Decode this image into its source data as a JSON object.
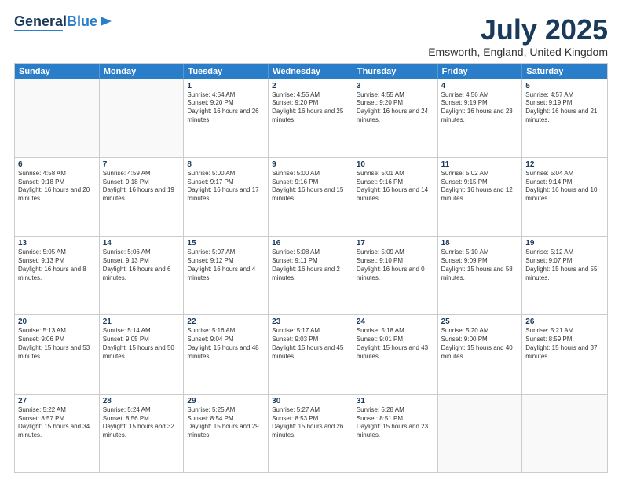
{
  "header": {
    "logo_general": "General",
    "logo_blue": "Blue",
    "month_year": "July 2025",
    "location": "Emsworth, England, United Kingdom"
  },
  "days_of_week": [
    "Sunday",
    "Monday",
    "Tuesday",
    "Wednesday",
    "Thursday",
    "Friday",
    "Saturday"
  ],
  "weeks": [
    [
      {
        "day": "",
        "sunrise": "",
        "sunset": "",
        "daylight": ""
      },
      {
        "day": "",
        "sunrise": "",
        "sunset": "",
        "daylight": ""
      },
      {
        "day": "1",
        "sunrise": "Sunrise: 4:54 AM",
        "sunset": "Sunset: 9:20 PM",
        "daylight": "Daylight: 16 hours and 26 minutes."
      },
      {
        "day": "2",
        "sunrise": "Sunrise: 4:55 AM",
        "sunset": "Sunset: 9:20 PM",
        "daylight": "Daylight: 16 hours and 25 minutes."
      },
      {
        "day": "3",
        "sunrise": "Sunrise: 4:55 AM",
        "sunset": "Sunset: 9:20 PM",
        "daylight": "Daylight: 16 hours and 24 minutes."
      },
      {
        "day": "4",
        "sunrise": "Sunrise: 4:56 AM",
        "sunset": "Sunset: 9:19 PM",
        "daylight": "Daylight: 16 hours and 23 minutes."
      },
      {
        "day": "5",
        "sunrise": "Sunrise: 4:57 AM",
        "sunset": "Sunset: 9:19 PM",
        "daylight": "Daylight: 16 hours and 21 minutes."
      }
    ],
    [
      {
        "day": "6",
        "sunrise": "Sunrise: 4:58 AM",
        "sunset": "Sunset: 9:18 PM",
        "daylight": "Daylight: 16 hours and 20 minutes."
      },
      {
        "day": "7",
        "sunrise": "Sunrise: 4:59 AM",
        "sunset": "Sunset: 9:18 PM",
        "daylight": "Daylight: 16 hours and 19 minutes."
      },
      {
        "day": "8",
        "sunrise": "Sunrise: 5:00 AM",
        "sunset": "Sunset: 9:17 PM",
        "daylight": "Daylight: 16 hours and 17 minutes."
      },
      {
        "day": "9",
        "sunrise": "Sunrise: 5:00 AM",
        "sunset": "Sunset: 9:16 PM",
        "daylight": "Daylight: 16 hours and 15 minutes."
      },
      {
        "day": "10",
        "sunrise": "Sunrise: 5:01 AM",
        "sunset": "Sunset: 9:16 PM",
        "daylight": "Daylight: 16 hours and 14 minutes."
      },
      {
        "day": "11",
        "sunrise": "Sunrise: 5:02 AM",
        "sunset": "Sunset: 9:15 PM",
        "daylight": "Daylight: 16 hours and 12 minutes."
      },
      {
        "day": "12",
        "sunrise": "Sunrise: 5:04 AM",
        "sunset": "Sunset: 9:14 PM",
        "daylight": "Daylight: 16 hours and 10 minutes."
      }
    ],
    [
      {
        "day": "13",
        "sunrise": "Sunrise: 5:05 AM",
        "sunset": "Sunset: 9:13 PM",
        "daylight": "Daylight: 16 hours and 8 minutes."
      },
      {
        "day": "14",
        "sunrise": "Sunrise: 5:06 AM",
        "sunset": "Sunset: 9:13 PM",
        "daylight": "Daylight: 16 hours and 6 minutes."
      },
      {
        "day": "15",
        "sunrise": "Sunrise: 5:07 AM",
        "sunset": "Sunset: 9:12 PM",
        "daylight": "Daylight: 16 hours and 4 minutes."
      },
      {
        "day": "16",
        "sunrise": "Sunrise: 5:08 AM",
        "sunset": "Sunset: 9:11 PM",
        "daylight": "Daylight: 16 hours and 2 minutes."
      },
      {
        "day": "17",
        "sunrise": "Sunrise: 5:09 AM",
        "sunset": "Sunset: 9:10 PM",
        "daylight": "Daylight: 16 hours and 0 minutes."
      },
      {
        "day": "18",
        "sunrise": "Sunrise: 5:10 AM",
        "sunset": "Sunset: 9:09 PM",
        "daylight": "Daylight: 15 hours and 58 minutes."
      },
      {
        "day": "19",
        "sunrise": "Sunrise: 5:12 AM",
        "sunset": "Sunset: 9:07 PM",
        "daylight": "Daylight: 15 hours and 55 minutes."
      }
    ],
    [
      {
        "day": "20",
        "sunrise": "Sunrise: 5:13 AM",
        "sunset": "Sunset: 9:06 PM",
        "daylight": "Daylight: 15 hours and 53 minutes."
      },
      {
        "day": "21",
        "sunrise": "Sunrise: 5:14 AM",
        "sunset": "Sunset: 9:05 PM",
        "daylight": "Daylight: 15 hours and 50 minutes."
      },
      {
        "day": "22",
        "sunrise": "Sunrise: 5:16 AM",
        "sunset": "Sunset: 9:04 PM",
        "daylight": "Daylight: 15 hours and 48 minutes."
      },
      {
        "day": "23",
        "sunrise": "Sunrise: 5:17 AM",
        "sunset": "Sunset: 9:03 PM",
        "daylight": "Daylight: 15 hours and 45 minutes."
      },
      {
        "day": "24",
        "sunrise": "Sunrise: 5:18 AM",
        "sunset": "Sunset: 9:01 PM",
        "daylight": "Daylight: 15 hours and 43 minutes."
      },
      {
        "day": "25",
        "sunrise": "Sunrise: 5:20 AM",
        "sunset": "Sunset: 9:00 PM",
        "daylight": "Daylight: 15 hours and 40 minutes."
      },
      {
        "day": "26",
        "sunrise": "Sunrise: 5:21 AM",
        "sunset": "Sunset: 8:59 PM",
        "daylight": "Daylight: 15 hours and 37 minutes."
      }
    ],
    [
      {
        "day": "27",
        "sunrise": "Sunrise: 5:22 AM",
        "sunset": "Sunset: 8:57 PM",
        "daylight": "Daylight: 15 hours and 34 minutes."
      },
      {
        "day": "28",
        "sunrise": "Sunrise: 5:24 AM",
        "sunset": "Sunset: 8:56 PM",
        "daylight": "Daylight: 15 hours and 32 minutes."
      },
      {
        "day": "29",
        "sunrise": "Sunrise: 5:25 AM",
        "sunset": "Sunset: 8:54 PM",
        "daylight": "Daylight: 15 hours and 29 minutes."
      },
      {
        "day": "30",
        "sunrise": "Sunrise: 5:27 AM",
        "sunset": "Sunset: 8:53 PM",
        "daylight": "Daylight: 15 hours and 26 minutes."
      },
      {
        "day": "31",
        "sunrise": "Sunrise: 5:28 AM",
        "sunset": "Sunset: 8:51 PM",
        "daylight": "Daylight: 15 hours and 23 minutes."
      },
      {
        "day": "",
        "sunrise": "",
        "sunset": "",
        "daylight": ""
      },
      {
        "day": "",
        "sunrise": "",
        "sunset": "",
        "daylight": ""
      }
    ]
  ]
}
